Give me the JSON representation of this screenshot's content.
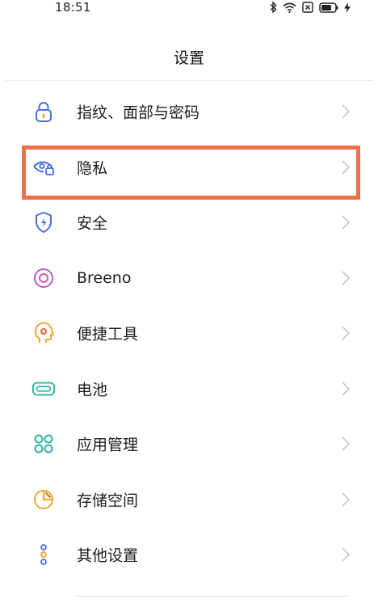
{
  "status_bar": {
    "time": "18:51",
    "icons": [
      "bluetooth-icon",
      "wifi-icon",
      "sim-icon",
      "battery-icon",
      "charging-icon"
    ]
  },
  "header": {
    "title": "设置"
  },
  "settings": {
    "items": [
      {
        "label": "指纹、面部与密码",
        "icon": "lock-icon",
        "color": "#4a6fd8"
      },
      {
        "label": "隐私",
        "icon": "privacy-eye-icon",
        "color": "#3d6bd6",
        "highlighted": true
      },
      {
        "label": "安全",
        "icon": "shield-icon",
        "color": "#4a6fd8"
      },
      {
        "label": "Breeno",
        "icon": "breeno-icon",
        "color": "#b45cc7"
      },
      {
        "label": "便捷工具",
        "icon": "smart-head-icon",
        "color": "#f0a630"
      },
      {
        "label": "电池",
        "icon": "battery-icon",
        "color": "#2bb3a3"
      },
      {
        "label": "应用管理",
        "icon": "apps-icon",
        "color": "#2bb3a3"
      },
      {
        "label": "存储空间",
        "icon": "storage-icon",
        "color": "#f0a630"
      },
      {
        "label": "其他设置",
        "icon": "more-icon",
        "color": "#4a6fd8"
      }
    ]
  },
  "highlight_color": "#ec7148"
}
